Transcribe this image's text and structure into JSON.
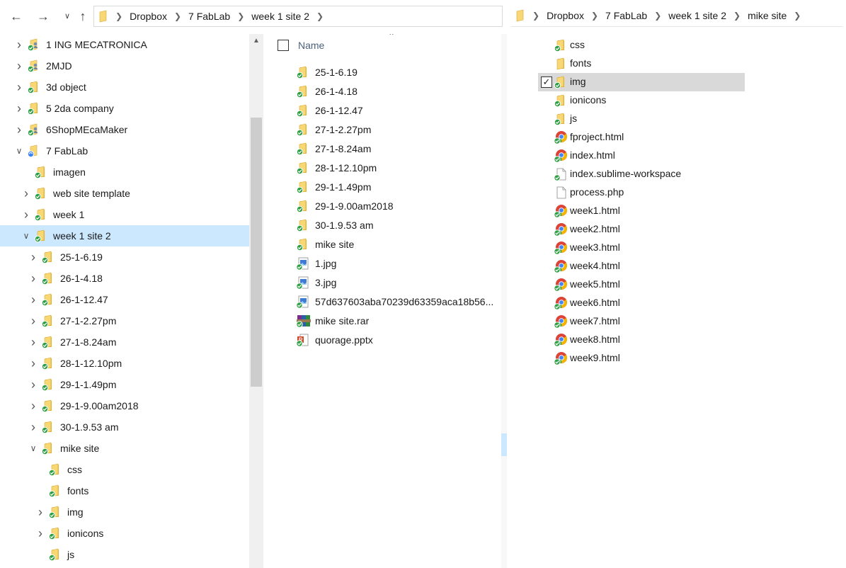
{
  "colors": {
    "selection": "#cce8ff",
    "folder": "#f8d775",
    "sync_green": "#2ea043",
    "header_text": "#4c607a"
  },
  "left_window": {
    "breadcrumb": [
      "Dropbox",
      "7 FabLab",
      "week 1 site 2"
    ],
    "tree": [
      {
        "label": "1 ING MECATRONICA",
        "icon": "shared-folder-icon",
        "expandable": true,
        "expanded": false,
        "level": 0
      },
      {
        "label": "2MJD",
        "icon": "shared-folder-icon",
        "expandable": true,
        "expanded": false,
        "level": 0
      },
      {
        "label": "3d object",
        "icon": "folder-icon",
        "expandable": true,
        "expanded": false,
        "level": 0
      },
      {
        "label": "5 2da company",
        "icon": "folder-icon",
        "expandable": true,
        "expanded": false,
        "level": 0
      },
      {
        "label": "6ShopMEcaMaker",
        "icon": "shared-folder-icon",
        "expandable": true,
        "expanded": false,
        "level": 0
      },
      {
        "label": "7 FabLab",
        "icon": "folder-sync-icon",
        "expandable": true,
        "expanded": true,
        "level": 0
      },
      {
        "label": "imagen",
        "icon": "folder-icon",
        "expandable": false,
        "expanded": false,
        "level": 1
      },
      {
        "label": "web site template",
        "icon": "folder-icon",
        "expandable": true,
        "expanded": false,
        "level": 1
      },
      {
        "label": "week 1",
        "icon": "folder-icon",
        "expandable": true,
        "expanded": false,
        "level": 1
      },
      {
        "label": "week 1 site 2",
        "icon": "folder-icon",
        "expandable": true,
        "expanded": true,
        "level": 1,
        "selected": true
      },
      {
        "label": "25-1-6.19",
        "icon": "folder-icon",
        "expandable": true,
        "expanded": false,
        "level": 2
      },
      {
        "label": "26-1-4.18",
        "icon": "folder-icon",
        "expandable": true,
        "expanded": false,
        "level": 2
      },
      {
        "label": "26-1-12.47",
        "icon": "folder-icon",
        "expandable": true,
        "expanded": false,
        "level": 2
      },
      {
        "label": "27-1-2.27pm",
        "icon": "folder-icon",
        "expandable": true,
        "expanded": false,
        "level": 2
      },
      {
        "label": "27-1-8.24am",
        "icon": "folder-icon",
        "expandable": true,
        "expanded": false,
        "level": 2
      },
      {
        "label": "28-1-12.10pm",
        "icon": "folder-icon",
        "expandable": true,
        "expanded": false,
        "level": 2
      },
      {
        "label": "29-1-1.49pm",
        "icon": "folder-icon",
        "expandable": true,
        "expanded": false,
        "level": 2
      },
      {
        "label": "29-1-9.00am2018",
        "icon": "folder-icon",
        "expandable": true,
        "expanded": false,
        "level": 2
      },
      {
        "label": "30-1.9.53 am",
        "icon": "folder-icon",
        "expandable": true,
        "expanded": false,
        "level": 2
      },
      {
        "label": "mike site",
        "icon": "folder-icon",
        "expandable": true,
        "expanded": true,
        "level": 2
      },
      {
        "label": "css",
        "icon": "folder-icon",
        "expandable": false,
        "expanded": false,
        "level": 3
      },
      {
        "label": "fonts",
        "icon": "folder-icon",
        "expandable": false,
        "expanded": false,
        "level": 3
      },
      {
        "label": "img",
        "icon": "folder-icon",
        "expandable": true,
        "expanded": false,
        "level": 3
      },
      {
        "label": "ionicons",
        "icon": "folder-icon",
        "expandable": true,
        "expanded": false,
        "level": 3
      },
      {
        "label": "js",
        "icon": "folder-icon",
        "expandable": false,
        "expanded": false,
        "level": 3
      }
    ],
    "list_header": {
      "name_label": "Name"
    },
    "files": [
      {
        "label": "25-1-6.19",
        "icon": "folder-icon"
      },
      {
        "label": "26-1-4.18",
        "icon": "folder-icon"
      },
      {
        "label": "26-1-12.47",
        "icon": "folder-icon"
      },
      {
        "label": "27-1-2.27pm",
        "icon": "folder-icon"
      },
      {
        "label": "27-1-8.24am",
        "icon": "folder-icon"
      },
      {
        "label": "28-1-12.10pm",
        "icon": "folder-icon"
      },
      {
        "label": "29-1-1.49pm",
        "icon": "folder-icon"
      },
      {
        "label": "29-1-9.00am2018",
        "icon": "folder-icon"
      },
      {
        "label": "30-1.9.53 am",
        "icon": "folder-icon"
      },
      {
        "label": "mike site",
        "icon": "folder-icon"
      },
      {
        "label": "1.jpg",
        "icon": "image-file-icon"
      },
      {
        "label": "3.jpg",
        "icon": "image-file-icon"
      },
      {
        "label": "57d637603aba70239d63359aca18b56...",
        "icon": "image-file-icon"
      },
      {
        "label": "mike site.rar",
        "icon": "rar-archive-icon"
      },
      {
        "label": "quorage.pptx",
        "icon": "pptx-file-icon"
      }
    ]
  },
  "right_window": {
    "breadcrumb": [
      "Dropbox",
      "7 FabLab",
      "week 1 site 2",
      "mike site"
    ],
    "files": [
      {
        "label": "css",
        "icon": "folder-icon",
        "sync": true
      },
      {
        "label": "fonts",
        "icon": "folder-icon",
        "sync": false
      },
      {
        "label": "img",
        "icon": "folder-icon",
        "sync": true,
        "selected": true,
        "checked": true
      },
      {
        "label": "ionicons",
        "icon": "folder-icon",
        "sync": true
      },
      {
        "label": "js",
        "icon": "folder-icon",
        "sync": true
      },
      {
        "label": "fproject.html",
        "icon": "chrome-html-icon",
        "sync": true
      },
      {
        "label": "index.html",
        "icon": "chrome-html-icon",
        "sync": true
      },
      {
        "label": "index.sublime-workspace",
        "icon": "blank-file-icon",
        "sync": true
      },
      {
        "label": "process.php",
        "icon": "blank-file-icon",
        "sync": false
      },
      {
        "label": "week1.html",
        "icon": "chrome-html-icon",
        "sync": true
      },
      {
        "label": "week2.html",
        "icon": "chrome-html-icon",
        "sync": true
      },
      {
        "label": "week3.html",
        "icon": "chrome-html-icon",
        "sync": true
      },
      {
        "label": "week4.html",
        "icon": "chrome-html-icon",
        "sync": true
      },
      {
        "label": "week5.html",
        "icon": "chrome-html-icon",
        "sync": true
      },
      {
        "label": "week6.html",
        "icon": "chrome-html-icon",
        "sync": true
      },
      {
        "label": "week7.html",
        "icon": "chrome-html-icon",
        "sync": true
      },
      {
        "label": "week8.html",
        "icon": "chrome-html-icon",
        "sync": true
      },
      {
        "label": "week9.html",
        "icon": "chrome-html-icon",
        "sync": true
      }
    ]
  }
}
